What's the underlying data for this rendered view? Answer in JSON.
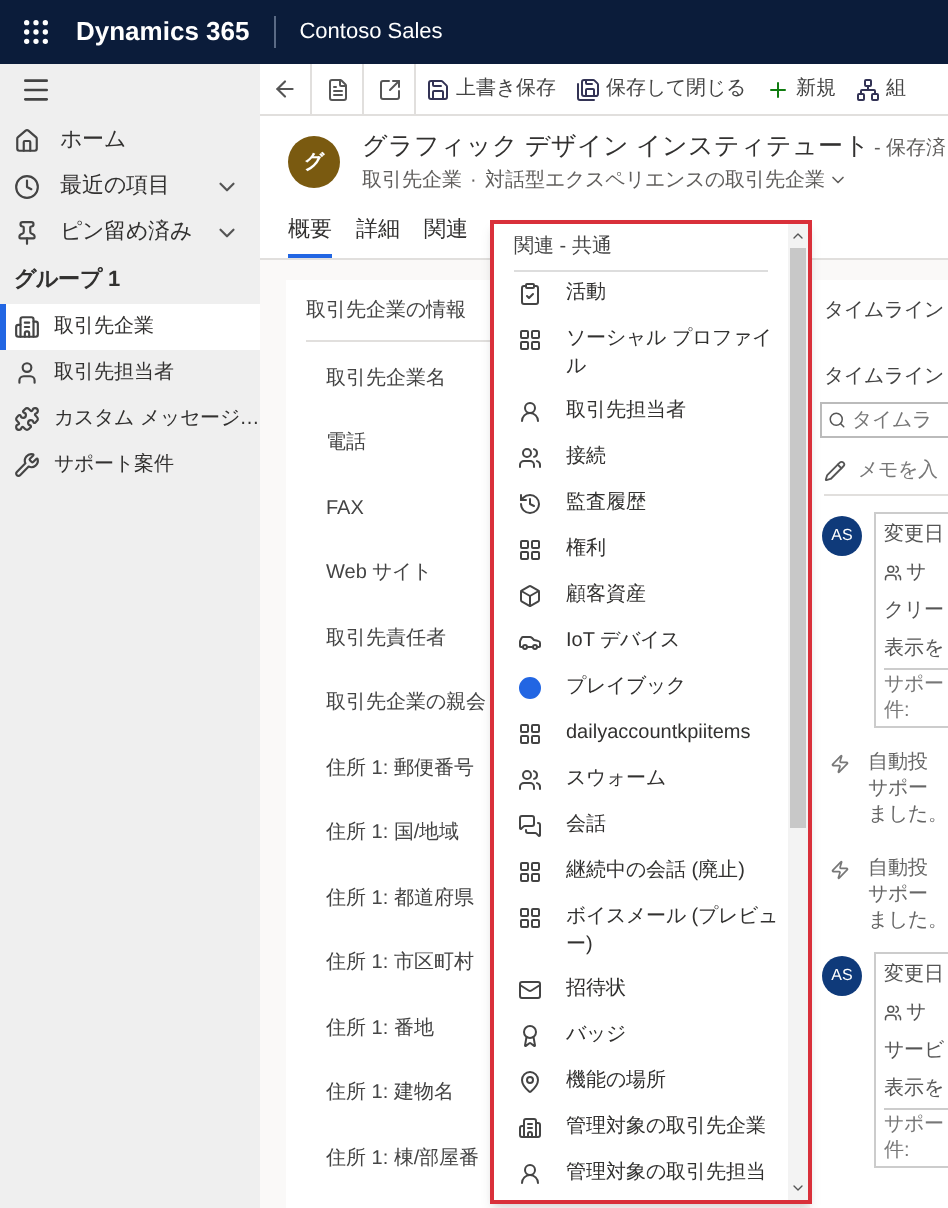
{
  "app_bar": {
    "title": "Dynamics 365",
    "app_name": "Contoso Sales"
  },
  "sidebar": {
    "items": [
      {
        "label": "ホーム",
        "expandable": false
      },
      {
        "label": "最近の項目",
        "expandable": true
      },
      {
        "label": "ピン留め済み",
        "expandable": true
      }
    ],
    "group": "グループ 1",
    "group_items": [
      {
        "label": "取引先企業",
        "selected": true
      },
      {
        "label": "取引先担当者",
        "selected": false
      },
      {
        "label": "カスタム メッセージ…",
        "selected": false
      },
      {
        "label": "サポート案件",
        "selected": false
      }
    ]
  },
  "command_bar": {
    "buttons": [
      {
        "label": "上書き保存"
      },
      {
        "label": "保存して閉じる"
      },
      {
        "label": "新規"
      },
      {
        "label": "組"
      }
    ]
  },
  "record": {
    "initial": "グ",
    "title": "グラフィック デザイン インスティテュート",
    "status": "- 保存済",
    "entity": "取引先企業",
    "separator": "·",
    "form": "対話型エクスペリエンスの取引先企業"
  },
  "tabs": [
    {
      "label": "概要",
      "selected": true
    },
    {
      "label": "詳細",
      "selected": false
    },
    {
      "label": "関連",
      "selected": false
    }
  ],
  "form": {
    "section": "取引先企業の情報",
    "fields": [
      "取引先企業名",
      "電話",
      "FAX",
      "Web サイト",
      "取引先責任者",
      "取引先企業の親会",
      "住所 1: 郵便番号",
      "住所 1: 国/地域",
      "住所 1: 都道府県",
      "住所 1: 市区町村",
      "住所 1: 番地",
      "住所 1: 建物名",
      "住所 1: 棟/部屋番"
    ]
  },
  "timeline": {
    "header": "タイムライン",
    "title": "タイムライン",
    "search_placeholder": "タイムラ",
    "note_placeholder": "メモを入",
    "entries": [
      {
        "kind": "note",
        "initials": "AS",
        "lines": [
          "変更日",
          "サ",
          "クリー",
          "表示を"
        ],
        "footer": [
          "サポー",
          "件:"
        ]
      },
      {
        "kind": "auto_post",
        "lines": [
          "自動投",
          "サポー",
          "ました。"
        ]
      },
      {
        "kind": "auto_post",
        "lines": [
          "自動投",
          "サポー",
          "ました。"
        ]
      },
      {
        "kind": "note",
        "initials": "AS",
        "lines": [
          "変更日",
          "サ",
          "サービ",
          "表示を"
        ],
        "footer": [
          "サポー",
          "件:"
        ]
      }
    ]
  },
  "related_menu": {
    "header": "関連 - 共通",
    "items": [
      "活動",
      "ソーシャル プロファイル",
      "取引先担当者",
      "接続",
      "監査履歴",
      "権利",
      "顧客資産",
      "IoT デバイス",
      "プレイブック",
      "dailyaccountkpiitems",
      "スウォーム",
      "会話",
      "継続中の会話 (廃止)",
      "ボイスメール (プレビュー)",
      "招待状",
      "バッジ",
      "機能の場所",
      "管理対象の取引先企業",
      "管理対象の取引先担当"
    ]
  }
}
